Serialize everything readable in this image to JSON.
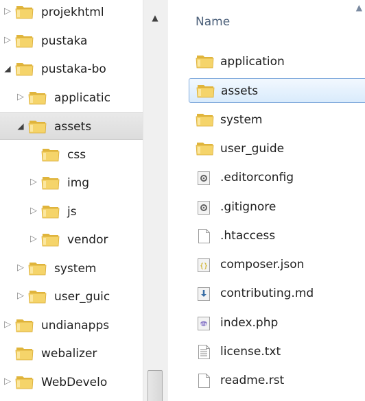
{
  "nav": {
    "items": [
      {
        "label": "projekhtml",
        "expander": "collapsed"
      },
      {
        "label": "pustaka",
        "expander": "collapsed"
      },
      {
        "label": "pustaka-bo",
        "expander": "expanded"
      },
      {
        "label": "applicatic",
        "expander": "collapsed"
      },
      {
        "label": "assets",
        "expander": "expanded",
        "selected": true
      },
      {
        "label": "css",
        "expander": "none"
      },
      {
        "label": "img",
        "expander": "collapsed"
      },
      {
        "label": "js",
        "expander": "collapsed"
      },
      {
        "label": "vendor",
        "expander": "collapsed"
      },
      {
        "label": "system",
        "expander": "collapsed"
      },
      {
        "label": "user_guic",
        "expander": "collapsed"
      },
      {
        "label": "undianapps",
        "expander": "collapsed"
      },
      {
        "label": "webalizer",
        "expander": "none"
      },
      {
        "label": "WebDevelo",
        "expander": "collapsed"
      }
    ]
  },
  "list": {
    "header": {
      "name": "Name"
    },
    "files": [
      {
        "name": "application",
        "icon": "folder-icon"
      },
      {
        "name": "assets",
        "icon": "folder-icon",
        "selected": true
      },
      {
        "name": "system",
        "icon": "folder-icon"
      },
      {
        "name": "user_guide",
        "icon": "folder-icon"
      },
      {
        "name": ".editorconfig",
        "icon": "config-file-icon"
      },
      {
        "name": ".gitignore",
        "icon": "config-file-icon"
      },
      {
        "name": ".htaccess",
        "icon": "blank-file-icon"
      },
      {
        "name": "composer.json",
        "icon": "json-file-icon"
      },
      {
        "name": "contributing.md",
        "icon": "markdown-file-icon"
      },
      {
        "name": "index.php",
        "icon": "php-file-icon"
      },
      {
        "name": "license.txt",
        "icon": "text-file-icon"
      },
      {
        "name": "readme.rst",
        "icon": "blank-file-icon"
      }
    ]
  },
  "colors": {
    "folder_front": "#f5d46a",
    "folder_back": "#e0b53c",
    "selection_border": "#84acdd",
    "header_text": "#4c607a"
  }
}
